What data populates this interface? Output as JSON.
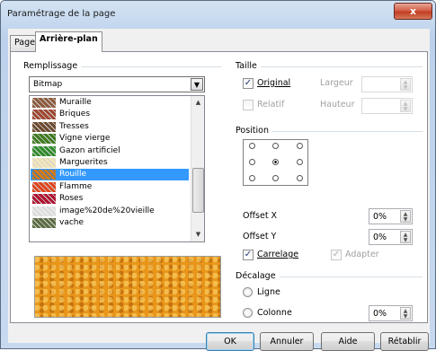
{
  "window": {
    "title": "Paramétrage de la page",
    "close_glyph": "x"
  },
  "tabs": [
    "Page",
    "Arrière-plan"
  ],
  "fill": {
    "group_label": "Remplissage",
    "type_value": "Bitmap",
    "items": [
      {
        "label": "Muraille",
        "color": "#8c5a3c"
      },
      {
        "label": "Briques",
        "color": "#a0452f"
      },
      {
        "label": "Tresses",
        "color": "#6d4a2e"
      },
      {
        "label": "Vigne vierge",
        "color": "#3f7a1f"
      },
      {
        "label": "Gazon artificiel",
        "color": "#2e8b2a"
      },
      {
        "label": "Marguerites",
        "color": "#f3e6b8"
      },
      {
        "label": "Rouille",
        "color": "#d97a12"
      },
      {
        "label": "Flamme",
        "color": "#e0441c"
      },
      {
        "label": "Roses",
        "color": "#b01030"
      },
      {
        "label": "image%20de%20vieille",
        "color": "#e8e8e8"
      },
      {
        "label": "vache",
        "color": "#5b6b42"
      }
    ],
    "selected": "Rouille",
    "preview_color": "#e8961a"
  },
  "size": {
    "group_label": "Taille",
    "original": "Original",
    "original_checked": true,
    "relatif": "Relatif",
    "largeur": "Largeur",
    "hauteur": "Hauteur"
  },
  "position": {
    "group_label": "Position",
    "offset_x_label": "Offset X",
    "offset_x_value": "0%",
    "offset_y_label": "Offset Y",
    "offset_y_value": "0%",
    "carrelage": "Carrelage",
    "carrelage_checked": true,
    "adapter": "Adapter",
    "adapter_checked": true
  },
  "decalage": {
    "group_label": "Décalage",
    "ligne": "Ligne",
    "colonne": "Colonne",
    "colonne_value": "0%"
  },
  "buttons": {
    "ok": "OK",
    "annuler": "Annuler",
    "aide": "Aide",
    "retablir": "Rétablir"
  }
}
